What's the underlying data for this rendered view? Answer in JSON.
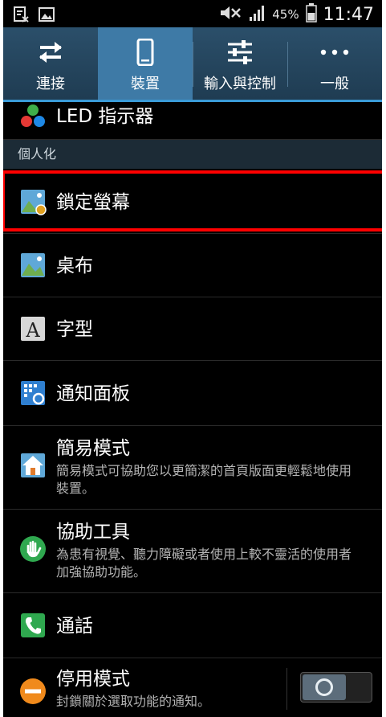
{
  "status_bar": {
    "battery_percent": "45%",
    "time": "11:47"
  },
  "tabs": [
    {
      "label": "連接",
      "icon": "swap-arrows-icon",
      "active": false
    },
    {
      "label": "裝置",
      "icon": "phone-icon",
      "active": true
    },
    {
      "label": "輸入與控制",
      "icon": "sliders-icon",
      "active": false
    },
    {
      "label": "一般",
      "icon": "more-dots-icon",
      "active": false
    }
  ],
  "list": {
    "led": {
      "title": "LED 指示器",
      "icon": "led-indicator-icon"
    },
    "section_personal": "個人化",
    "lock_screen": {
      "title": "鎖定螢幕",
      "icon": "lock-screen-icon"
    },
    "wallpaper": {
      "title": "桌布",
      "icon": "wallpaper-icon"
    },
    "font": {
      "title": "字型",
      "icon": "font-icon"
    },
    "notification_panel": {
      "title": "通知面板",
      "icon": "notification-panel-icon"
    },
    "easy_mode": {
      "title": "簡易模式",
      "subtitle": "簡易模式可協助您以更簡潔的首頁版面更輕鬆地使用裝置。",
      "icon": "home-icon"
    },
    "accessibility": {
      "title": "協助工具",
      "subtitle": "為患有視覺、聽力障礙或者使用上較不靈活的使用者加強協助功能。",
      "icon": "hand-icon"
    },
    "call": {
      "title": "通話",
      "icon": "phone-call-icon"
    },
    "blocking_mode": {
      "title": "停用模式",
      "subtitle": "封鎖關於選取功能的通知。",
      "icon": "block-icon",
      "toggle": "off"
    }
  }
}
